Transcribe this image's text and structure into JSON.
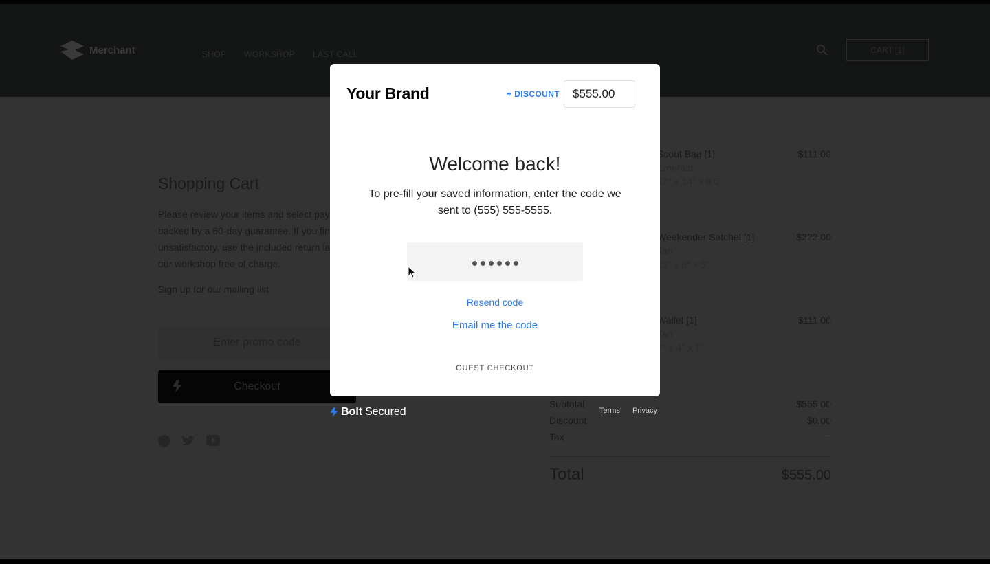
{
  "header": {
    "logo": "Merchant",
    "nav": [
      "SHOP",
      "WORKSHOP",
      "LAST CALL"
    ],
    "cart": "CART [1]"
  },
  "cart": {
    "title": "Shopping Cart",
    "description": "Please review your items and select payment backed by a 60-day guarantee. If you find unsatisfactory, use the included return label to our workshop free of charge.",
    "mailing": "Sign up for our mailing list",
    "promo_placeholder": "Enter promo code",
    "checkout": "Checkout"
  },
  "items": [
    {
      "name": "Scout Bag [1]",
      "variant": "Emerald",
      "size": "17\" x 14\" x 8.5\"",
      "price": "$111.00"
    },
    {
      "name": "Weekender Satchel [1]",
      "variant": "Tan",
      "size": "12\" x 8\" x 5\"",
      "price": "$222.00"
    },
    {
      "name": "Wallet [1]",
      "variant": "Tan",
      "size": "7\" x 4\" x 1\"",
      "price": "$111.00"
    }
  ],
  "summary": {
    "subtotal_label": "Subtotal",
    "subtotal": "$555.00",
    "discount_label": "Discount",
    "discount": "$0.00",
    "tax_label": "Tax",
    "tax": "–",
    "total_label": "Total",
    "total": "$555.00"
  },
  "modal": {
    "brand": "Your Brand",
    "discount_link": "+ DISCOUNT",
    "amount": "$555.00",
    "title": "Welcome back!",
    "message": "To pre-fill your saved information, enter the code we sent to (555) 555-5555.",
    "code_length": 6,
    "resend": "Resend code",
    "email": "Email me the code",
    "guest": "GUEST CHECKOUT"
  },
  "footer": {
    "bolt": "Bolt",
    "secured": "Secured",
    "terms": "Terms",
    "privacy": "Privacy"
  },
  "colors": {
    "accent": "#2b7bf2",
    "overlay": "#333333",
    "header": "#141515"
  }
}
